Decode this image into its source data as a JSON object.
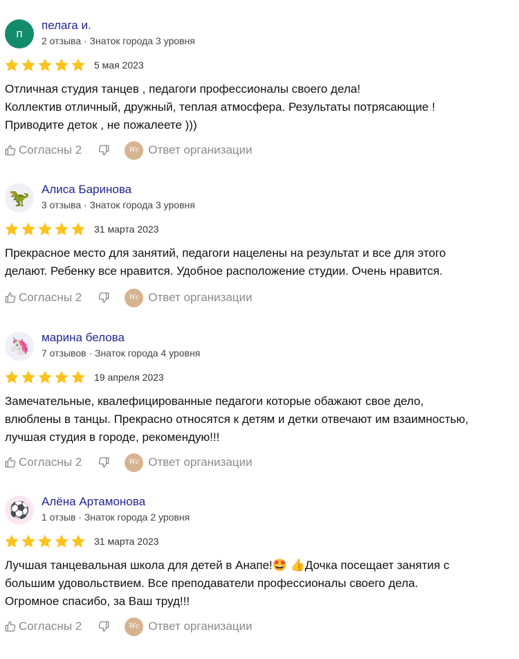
{
  "reviews": [
    {
      "avatar": {
        "type": "letter",
        "content": "п",
        "color": "#138b6d"
      },
      "name": "пелага и.",
      "meta": "2 отзыва · Знаток города 3 уровня",
      "rating": 5,
      "date": "5 мая 2023",
      "text": "Отличная студия танцев , педагоги профессионалы своего дела!\nКоллектив отличный, дружный, теплая атмосфера. Результаты потрясающие !\nПриводите деток , не пожалеете )))",
      "like_label": "Согласны 2",
      "org_reply_label": "Ответ организации"
    },
    {
      "avatar": {
        "type": "emoji",
        "content": "🦖",
        "icon": "dinosaur-avatar-icon"
      },
      "name": "Алиса Баринова",
      "meta": "3 отзыва · Знаток города 3 уровня",
      "rating": 5,
      "date": "31 марта 2023",
      "text": "Прекрасное место для занятий, педагоги нацелены на результат и все для этого\nделают. Ребенку все нравится. Удобное расположение студии. Очень нравится.",
      "like_label": "Согласны 2",
      "org_reply_label": "Ответ организации"
    },
    {
      "avatar": {
        "type": "emoji",
        "content": "🦄",
        "icon": "unicorn-avatar-icon"
      },
      "name": "марина белова",
      "meta": "7 отзывов · Знаток города 4 уровня",
      "rating": 5,
      "date": "19 апреля 2023",
      "text": "Замечательные, квалефицированные педагоги которые обажают свое дело,\nвлюблены в танцы. Прекрасно относятся к детям и детки отвечают им взаимностью,\nлучшая студия в городе, рекомендую!!!",
      "like_label": "Согласны 2",
      "org_reply_label": "Ответ организации"
    },
    {
      "avatar": {
        "type": "emoji",
        "content": "⚽",
        "icon": "soccer-ball-avatar-icon"
      },
      "name": "Алёна Артамонова",
      "meta": "1 отзыв · Знаток города 2 уровня",
      "rating": 5,
      "date": "31 марта 2023",
      "text": "Лучшая танцевальная школа для детей в Анапе!🤩 👍Дочка посещает занятия с\nбольшим удовольствием. Все преподаватели профессионалы своего дела.\nОгромное спасибо, за Ваш труд!!!",
      "like_label": "Согласны 2",
      "org_reply_label": "Ответ организации"
    }
  ],
  "colors": {
    "star": "#fcc21e",
    "name": "#222590",
    "action": "#8a8a8a",
    "org_logo": "#d7b491"
  },
  "icons": {
    "like": "thumbs-up-icon",
    "dislike": "thumbs-down-icon",
    "star": "star-icon"
  }
}
